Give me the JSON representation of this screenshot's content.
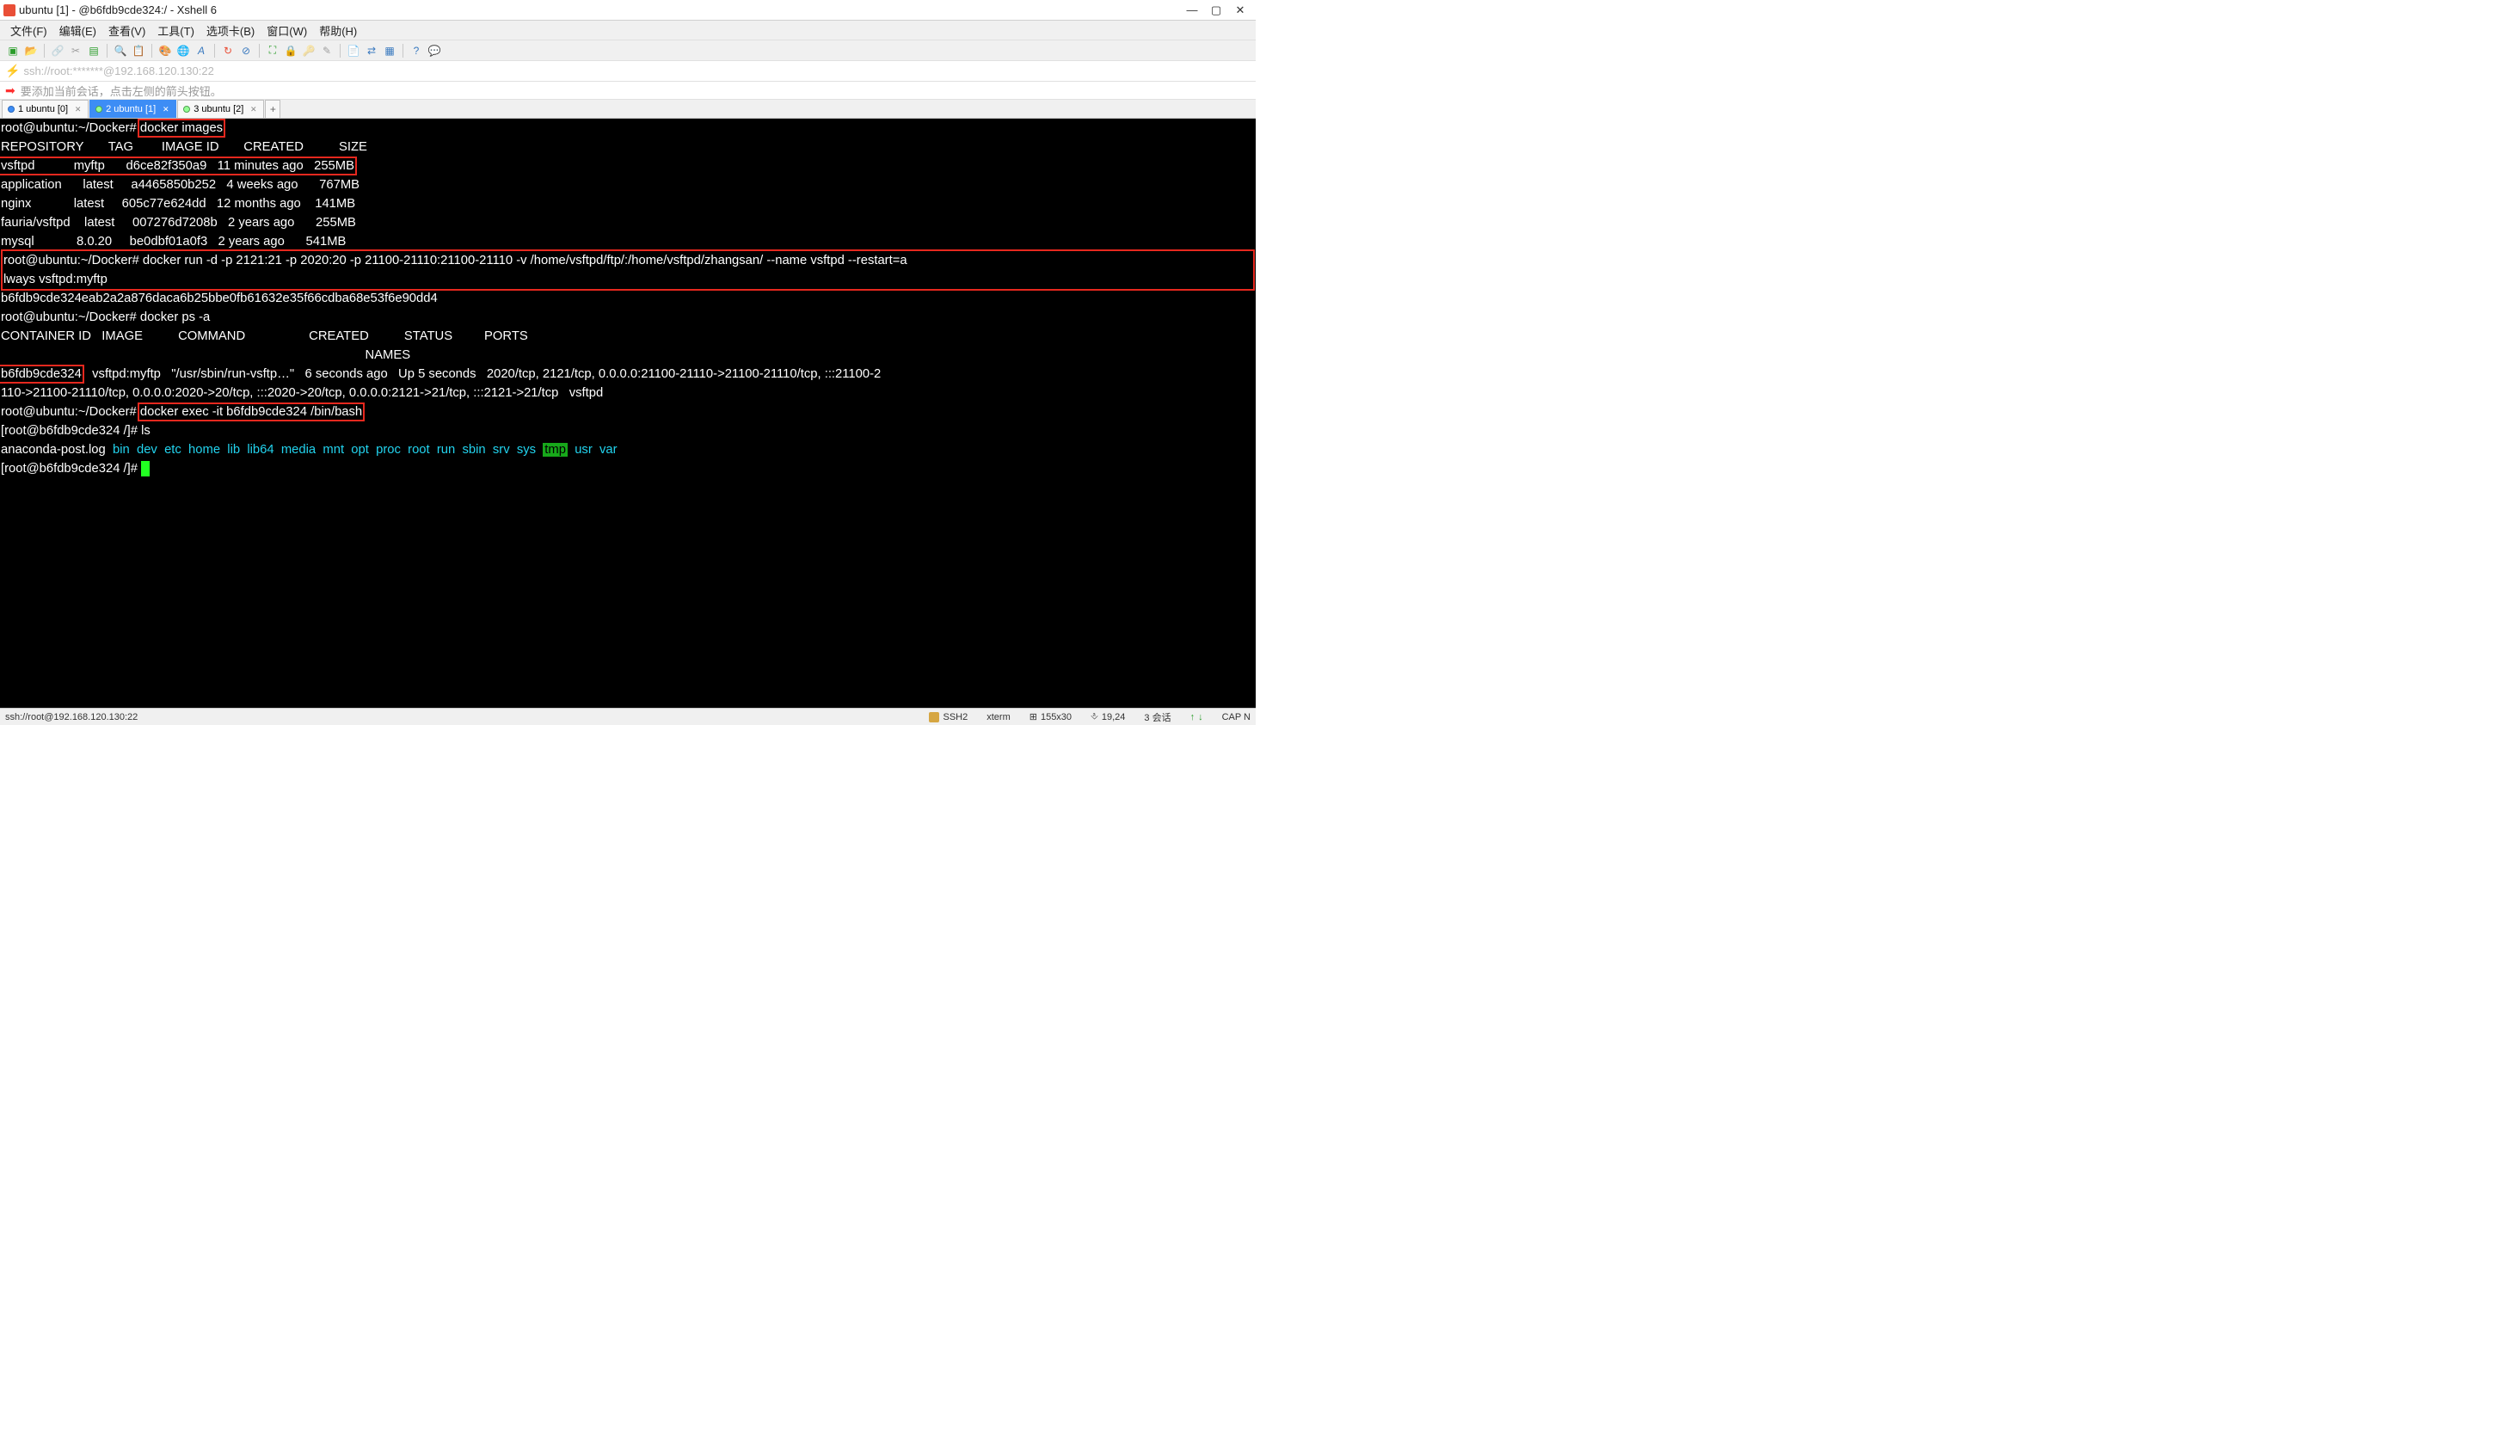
{
  "window": {
    "title": "ubuntu [1] - @b6fdb9cde324:/ - Xshell 6"
  },
  "menu": {
    "items": [
      "文件(F)",
      "编辑(E)",
      "查看(V)",
      "工具(T)",
      "选项卡(B)",
      "窗口(W)",
      "帮助(H)"
    ]
  },
  "address": {
    "url": "ssh://root:*******@192.168.120.130:22"
  },
  "hint": {
    "text": "要添加当前会话，点击左侧的箭头按钮。"
  },
  "tabs": [
    {
      "label": "1 ubuntu [0]",
      "active": false
    },
    {
      "label": "2 ubuntu [1]",
      "active": true
    },
    {
      "label": "3 ubuntu [2]",
      "active": false
    }
  ],
  "terminal": {
    "prompt1": "root@ubuntu:~/Docker# ",
    "cmd_images": "docker images",
    "images_header": "REPOSITORY       TAG        IMAGE ID       CREATED          SIZE",
    "images_rows": [
      {
        "repo": "vsftpd",
        "tag": "myftp",
        "id": "d6ce82f350a9",
        "created": "11 minutes ago",
        "size": "255MB"
      },
      {
        "repo": "application",
        "tag": "latest",
        "id": "a4465850b252",
        "created": "4 weeks ago",
        "size": "767MB"
      },
      {
        "repo": "nginx",
        "tag": "latest",
        "id": "605c77e624dd",
        "created": "12 months ago",
        "size": "141MB"
      },
      {
        "repo": "fauria/vsftpd",
        "tag": "latest",
        "id": "007276d7208b",
        "created": "2 years ago",
        "size": "255MB"
      },
      {
        "repo": "mysql",
        "tag": "8.0.20",
        "id": "be0dbf01a0f3",
        "created": "2 years ago",
        "size": "541MB"
      }
    ],
    "cmd_run_line1": "root@ubuntu:~/Docker# docker run -d -p 2121:21 -p 2020:20 -p 21100-21110:21100-21110 -v /home/vsftpd/ftp/:/home/vsftpd/zhangsan/ --name vsftpd --restart=a",
    "cmd_run_line2": "lways vsftpd:myftp",
    "run_output": "b6fdb9cde324eab2a2a876daca6b25bbe0fb61632e35f66cdba68e53f6e90dd4",
    "cmd_psa": "root@ubuntu:~/Docker# docker ps -a",
    "ps_header": "CONTAINER ID   IMAGE          COMMAND                  CREATED          STATUS         PORTS",
    "ps_names_header": "                                                                                                       NAMES",
    "container_id": "b6fdb9cde324",
    "ps_row_rest": "   vsftpd:myftp   \"/usr/sbin/run-vsftp…\"   6 seconds ago   Up 5 seconds   2020/tcp, 2121/tcp, 0.0.0.0:21100-21110->21100-21110/tcp, :::21100-2",
    "ps_row2": "110->21100-21110/tcp, 0.0.0.0:2020->20/tcp, :::2020->20/tcp, 0.0.0.0:2121->21/tcp, :::2121->21/tcp   vsftpd",
    "cmd_exec_prefix": "root@ubuntu:~/Docker# ",
    "cmd_exec": "docker exec -it b6fdb9cde324 /bin/bash",
    "inside_prompt": "[root@b6fdb9cde324 /]# ",
    "cmd_ls": "ls",
    "ls_plain": "anaconda-post.log  ",
    "ls_dirs": [
      "bin",
      "dev",
      "etc",
      "home",
      "lib",
      "lib64",
      "media",
      "mnt",
      "opt",
      "proc",
      "root",
      "run",
      "sbin",
      "srv",
      "sys"
    ],
    "ls_tmp": "tmp",
    "ls_dirs2": [
      "usr",
      "var"
    ]
  },
  "statusbar": {
    "left": "ssh://root@192.168.120.130:22",
    "ssh": "SSH2",
    "term": "xterm",
    "size": "155x30",
    "pos": "19,24",
    "sessions": "3 会话",
    "cap": "CAP N",
    "updown": "⇵  "
  }
}
